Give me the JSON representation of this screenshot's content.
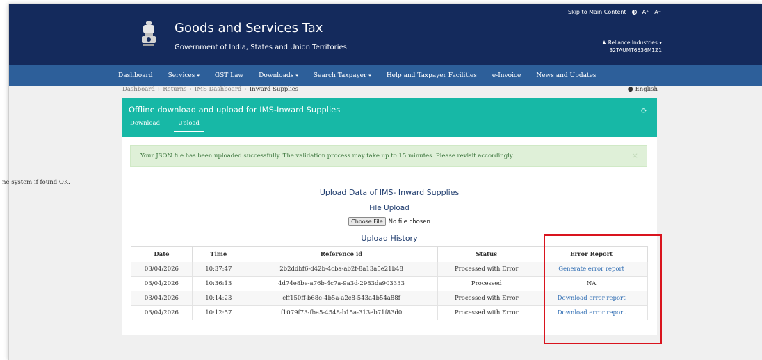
{
  "header": {
    "skip_link": "Skip to Main Content",
    "font_a_plus": "A⁺",
    "font_a_minus": "A⁻",
    "title": "Goods and Services Tax",
    "subtitle": "Government of India, States and Union Territories",
    "user_name": "Reliance Industries",
    "gstin": "32TAUMT6536M1Z1"
  },
  "nav": {
    "items": [
      {
        "label": "Dashboard",
        "dropdown": false
      },
      {
        "label": "Services",
        "dropdown": true
      },
      {
        "label": "GST Law",
        "dropdown": false
      },
      {
        "label": "Downloads",
        "dropdown": true
      },
      {
        "label": "Search Taxpayer",
        "dropdown": true
      },
      {
        "label": "Help and Taxpayer Facilities",
        "dropdown": false
      },
      {
        "label": "e-Invoice",
        "dropdown": false
      },
      {
        "label": "News and Updates",
        "dropdown": false
      }
    ]
  },
  "breadcrumb": {
    "items": [
      "Dashboard",
      "Returns",
      "IMS Dashboard",
      "Inward Supplies"
    ],
    "language": "English"
  },
  "panel": {
    "title": "Offline download and upload for IMS-Inward Supplies",
    "tab_download": "Download",
    "tab_upload": "Upload"
  },
  "alert": {
    "message": "Your JSON file has been uploaded successfully. The validation process may take up to 15 minutes. Please revisit accordingly.",
    "close": "×"
  },
  "partial_text": "ne system if found OK.",
  "upload": {
    "heading": "Upload Data of IMS- Inward Supplies",
    "file_upload_label": "File Upload",
    "choose_file_button": "Choose File",
    "no_file_text": "No file chosen",
    "history_heading": "Upload History"
  },
  "table": {
    "headers": [
      "Date",
      "Time",
      "Reference id",
      "Status",
      "Error Report"
    ],
    "rows": [
      {
        "date": "03/04/2026",
        "time": "10:37:47",
        "ref": "2b2ddbf6-d42b-4cba-ab2f-8a13a5e21b48",
        "status": "Processed with Error",
        "report": "Generate error report",
        "is_link": true
      },
      {
        "date": "03/04/2026",
        "time": "10:36:13",
        "ref": "4d74e8be-a76b-4c7a-9a3d-2983da903333",
        "status": "Processed",
        "report": "NA",
        "is_link": false
      },
      {
        "date": "03/04/2026",
        "time": "10:14:23",
        "ref": "cff150ff-b68e-4b5a-a2c8-543a4b54a88f",
        "status": "Processed with Error",
        "report": "Download error report",
        "is_link": true
      },
      {
        "date": "03/04/2026",
        "time": "10:12:57",
        "ref": "f1079f73-fba5-4548-b15a-313eb71f83d0",
        "status": "Processed with Error",
        "report": "Download error report",
        "is_link": true
      }
    ]
  },
  "colors": {
    "header_bg": "#142a5c",
    "nav_bg": "#2d5f9a",
    "panel_teal": "#17b8a6",
    "alert_bg": "#dff0d8",
    "link": "#2f6db3",
    "highlight_red": "#d9141e"
  }
}
